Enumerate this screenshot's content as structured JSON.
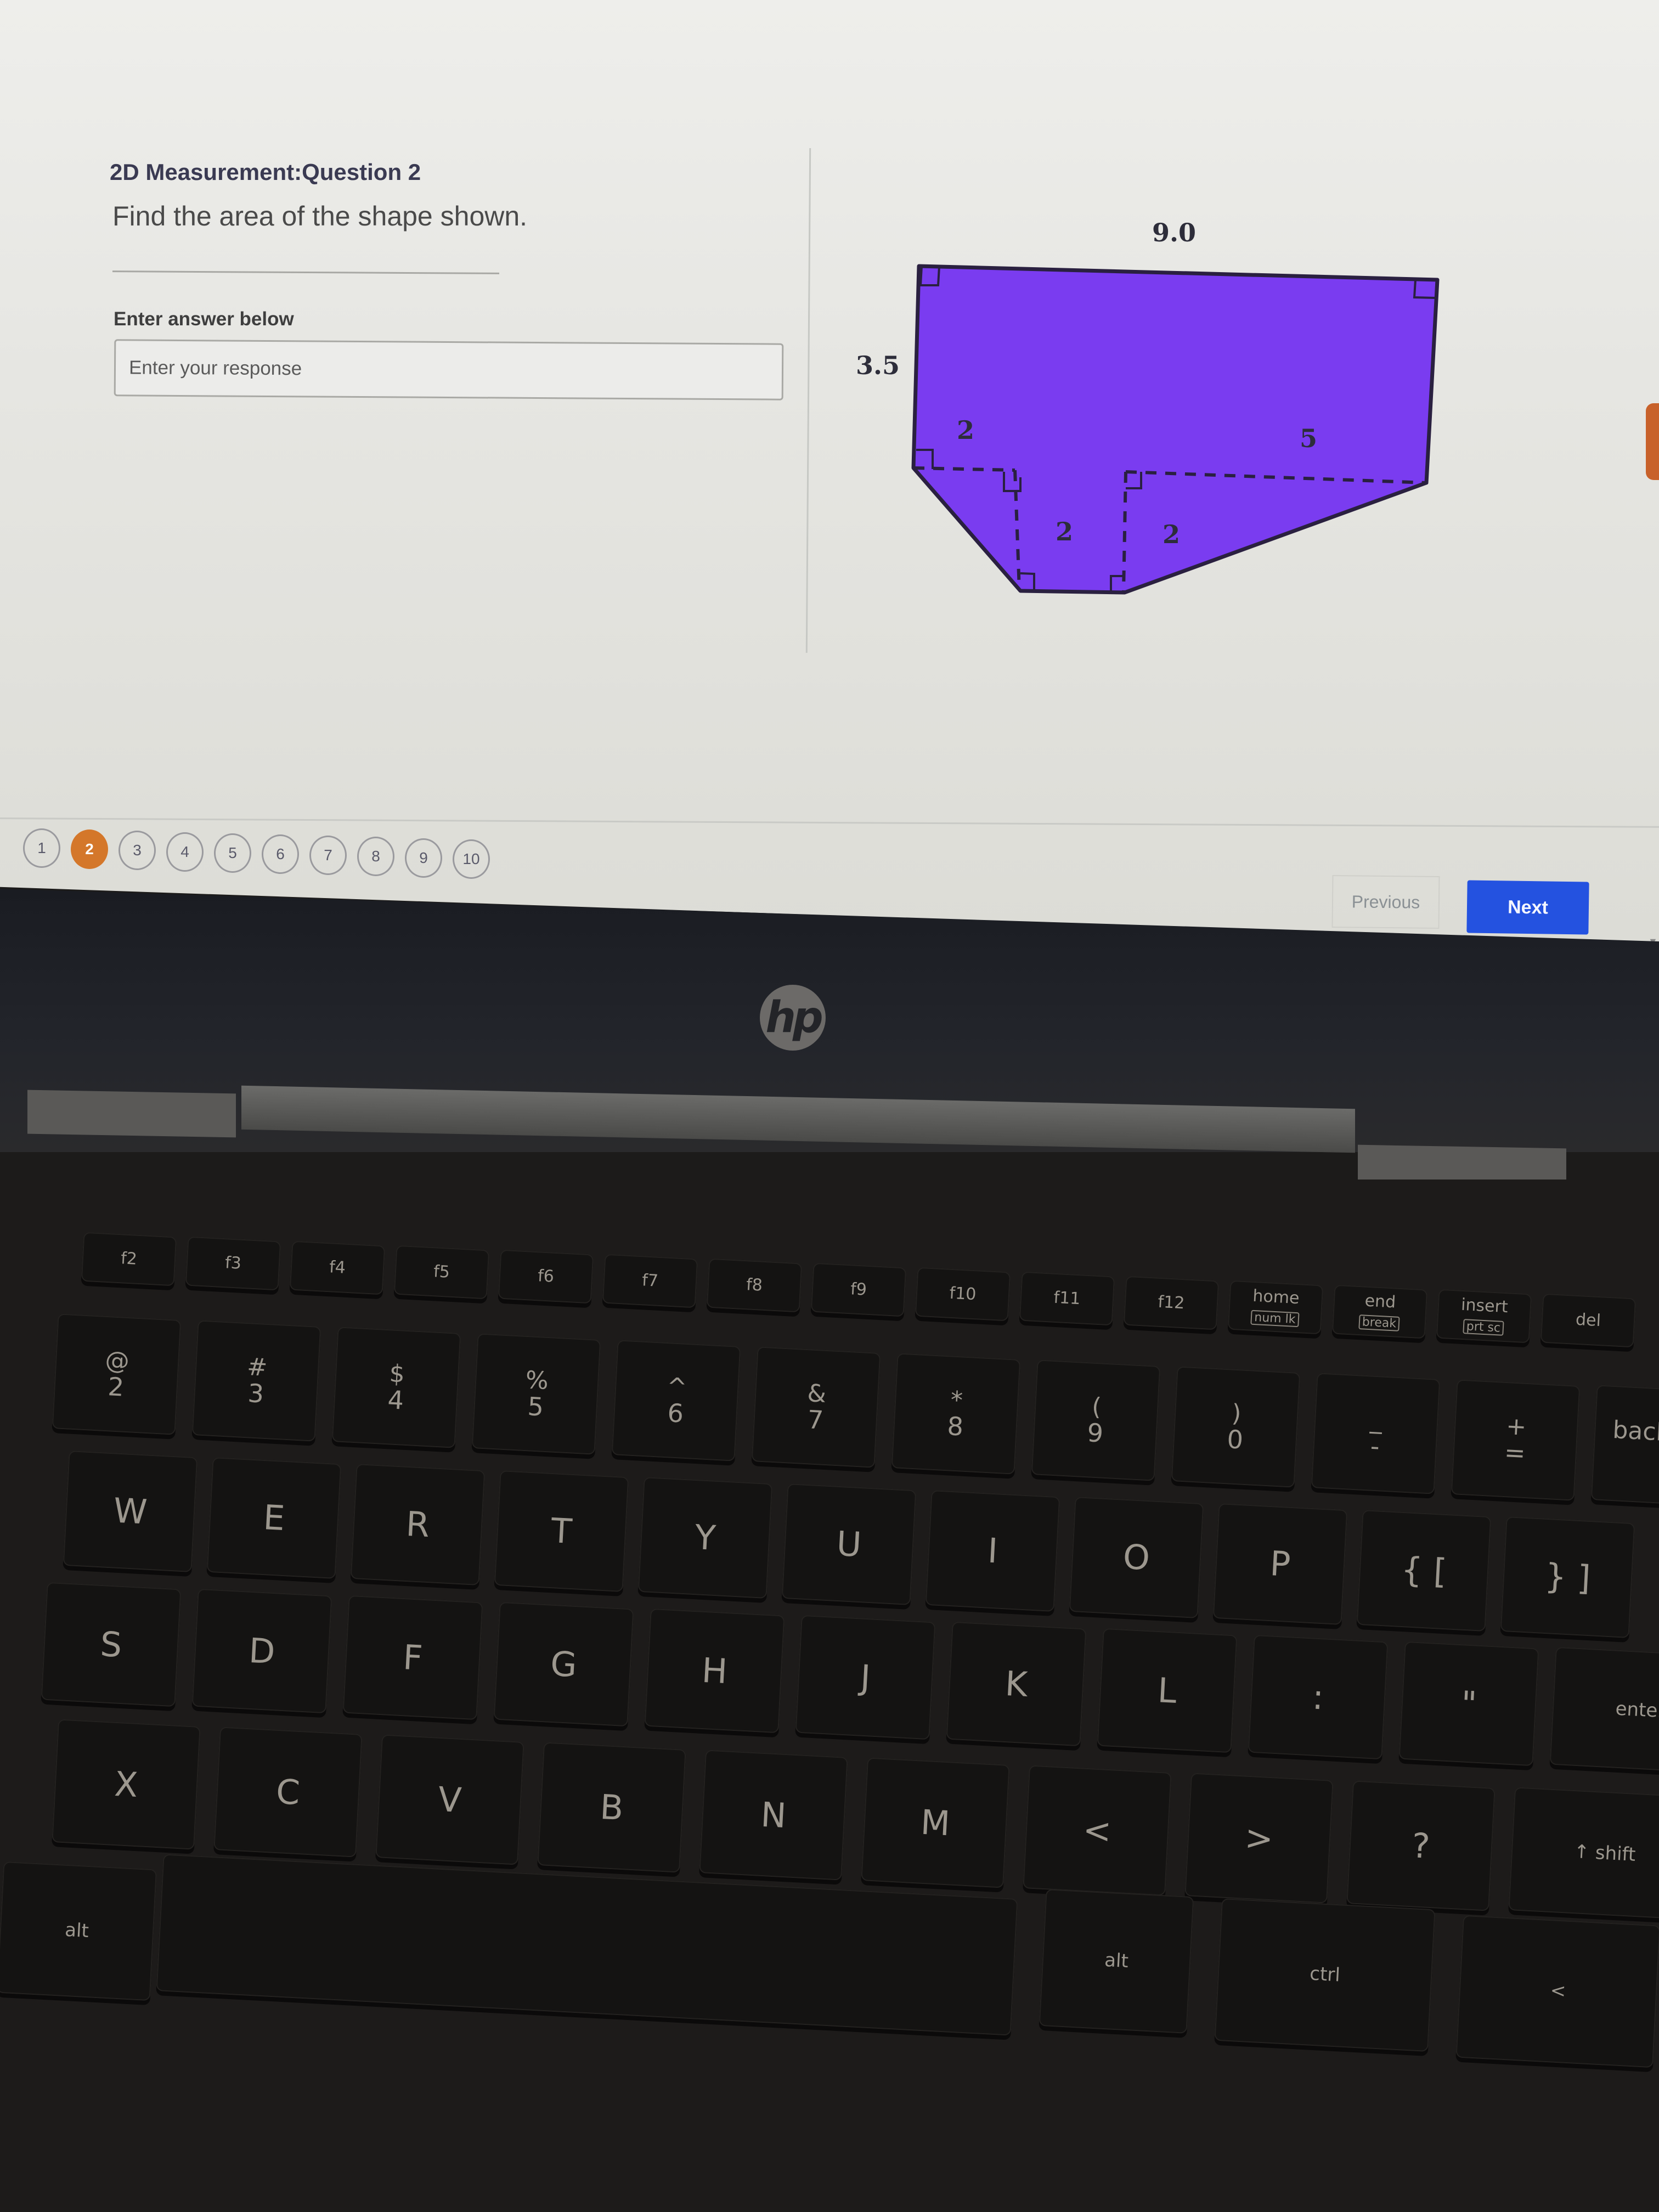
{
  "quiz": {
    "title": "2D Measurement:Question 2",
    "prompt": "Find the area of the shape shown.",
    "answer_label": "Enter answer below",
    "answer_placeholder": "Enter your response",
    "answer_value": ""
  },
  "figure": {
    "fill_color": "#7a3cf0",
    "stroke_color": "#2a2040",
    "labels": {
      "top_width": "9.0",
      "left_height": "3.5",
      "left_segment": "2",
      "right_segment": "5",
      "left_drop": "2",
      "right_drop": "2"
    }
  },
  "pagination": {
    "current": 2,
    "pages": [
      "1",
      "2",
      "3",
      "4",
      "5",
      "6",
      "7",
      "8",
      "9",
      "10"
    ],
    "active_color": "#d4772a"
  },
  "nav": {
    "previous_label": "Previous",
    "next_label": "Next",
    "next_color": "#2452e0"
  },
  "laptop": {
    "brand": "hp"
  },
  "keyboard": {
    "function_row": [
      "f2",
      "f3",
      "f4",
      "f5",
      "f6",
      "f7",
      "f8",
      "f9",
      "f10",
      "f11",
      "f12",
      "home",
      "end",
      "insert",
      "del"
    ],
    "function_sublabels": {
      "home": "num lk",
      "end": "break",
      "insert": "prt sc"
    },
    "number_row": [
      {
        "top": "@",
        "bot": "2"
      },
      {
        "top": "#",
        "bot": "3"
      },
      {
        "top": "$",
        "bot": "4"
      },
      {
        "top": "%",
        "bot": "5"
      },
      {
        "top": "^",
        "bot": "6"
      },
      {
        "top": "&",
        "bot": "7"
      },
      {
        "top": "*",
        "bot": "8"
      },
      {
        "top": "(",
        "bot": "9"
      },
      {
        "top": ")",
        "bot": "0"
      },
      {
        "top": "_",
        "bot": "-"
      },
      {
        "top": "+",
        "bot": "="
      },
      {
        "top": "backspace",
        "bot": "←"
      }
    ],
    "qwerty_row": [
      "W",
      "E",
      "R",
      "T",
      "Y",
      "U",
      "I",
      "O",
      "P",
      "{ [",
      "} ]"
    ],
    "home_row": [
      "S",
      "D",
      "F",
      "G",
      "H",
      "J",
      "K",
      "L",
      ":",
      "\"",
      "enter"
    ],
    "bottom_row": [
      "X",
      "C",
      "V",
      "B",
      "N",
      "M",
      "<",
      ">",
      "?",
      "↑ shift"
    ],
    "space_row": [
      "alt",
      "alt",
      "ctrl",
      "<"
    ]
  }
}
